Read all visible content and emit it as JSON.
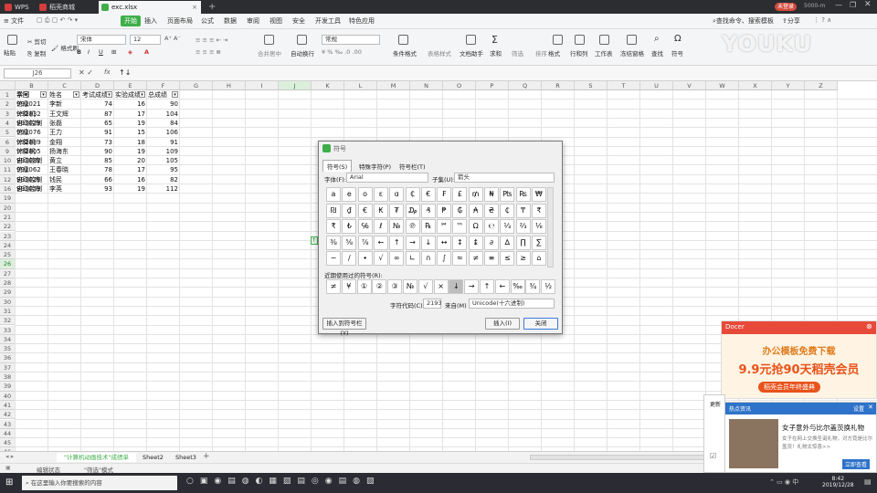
{
  "window": {
    "tabs": [
      {
        "label": "WPS",
        "color": "#d43d3d"
      },
      {
        "label": "稻壳商城",
        "color": "#d43d3d"
      },
      {
        "label": "exc.xlsx",
        "color": "#3fae4a"
      }
    ],
    "new_tab": "+",
    "user": "未登录",
    "user2": "5000-m"
  },
  "menu": {
    "file": "文件",
    "items": [
      "开始",
      "插入",
      "页面布局",
      "公式",
      "数据",
      "审阅",
      "视图",
      "安全",
      "开发工具",
      "特色应用"
    ],
    "search": "查找命令、搜索模板",
    "share": "分享"
  },
  "toolbar": {
    "paste": "粘贴",
    "cut": "剪切",
    "copy": "复制",
    "format_painter": "格式刷",
    "font": "宋体",
    "size": "12",
    "merge": "合并居中",
    "wrap": "自动换行",
    "numfmt": "常规",
    "cond": "条件格式",
    "table_style": "表格样式",
    "doc_assist": "文档助手",
    "sum": "求和",
    "filter": "筛选",
    "sort": "排序",
    "format": "格式",
    "rowcol": "行和列",
    "sheet": "工作表",
    "freeze": "冻结窗格",
    "find": "查找",
    "symbol": "符号",
    "watermark": "YOUKU"
  },
  "formula": {
    "namebox": "J26",
    "fx": "fx",
    "content": "↑↓"
  },
  "sheet": {
    "cols": [
      "A",
      "B",
      "C",
      "D",
      "E",
      "F",
      "G",
      "H",
      "I",
      "J",
      "K",
      "L",
      "M",
      "N",
      "O",
      "P",
      "Q",
      "R",
      "S",
      "T",
      "U",
      "V",
      "W",
      "X",
      "Y",
      "Z"
    ],
    "rows": [
      "1",
      "2",
      "3",
      "4",
      "5",
      "6",
      "9",
      "10",
      "11",
      "12",
      "16",
      "19",
      "20",
      "21",
      "22",
      "23",
      "24",
      "25",
      "26",
      "27",
      "28",
      "29",
      "30",
      "31",
      "32",
      "33",
      "34",
      "35",
      "36",
      "37",
      "38",
      "39",
      "40",
      "41",
      "42",
      "43",
      "44",
      "45",
      "46"
    ],
    "headers": [
      "系别",
      "学号",
      "姓名",
      "考试成绩",
      "实验成绩",
      "总成绩"
    ],
    "data": [
      [
        "信息",
        "991021",
        "李新",
        "74",
        "16",
        "90"
      ],
      [
        "计算机",
        "992032",
        "王文辉",
        "87",
        "17",
        "104"
      ],
      [
        "自动控制",
        "993023",
        "张磊",
        "65",
        "19",
        "84"
      ],
      [
        "信息",
        "991076",
        "王力",
        "91",
        "15",
        "106"
      ],
      [
        "计算机",
        "992089",
        "金翔",
        "73",
        "18",
        "91"
      ],
      [
        "计算机",
        "992005",
        "扬海东",
        "90",
        "19",
        "109"
      ],
      [
        "自动控制",
        "993082",
        "黄立",
        "85",
        "20",
        "105"
      ],
      [
        "信息",
        "991062",
        "王春晓",
        "78",
        "17",
        "95"
      ],
      [
        "自动控制",
        "993026",
        "钱民",
        "66",
        "16",
        "82"
      ],
      [
        "自动控制",
        "993053",
        "李英",
        "93",
        "19",
        "112"
      ]
    ],
    "sheets": [
      "\"计算机动画技术\"成绩单",
      "Sheet2",
      "Sheet3"
    ],
    "add_sheet": "+"
  },
  "status": {
    "mode": "编辑状态",
    "filter": "\"筛选\"模式"
  },
  "dialog": {
    "title": "符号",
    "tabs": [
      "符号(S)",
      "特殊字符(P)",
      "符号栏(T)"
    ],
    "font_label": "字体(F):",
    "font": "Arial",
    "subset_label": "子集(U):",
    "subset": "箭头",
    "grid": [
      [
        "a",
        "e",
        "o",
        "ɛ",
        "ɑ",
        "₵",
        "€",
        "₣",
        "£",
        "₥",
        "₦",
        "₧",
        "₨",
        "₩"
      ],
      [
        "₪",
        "₫",
        "€",
        "₭",
        "₮",
        "₯",
        "₰",
        "₱",
        "₲",
        "₳",
        "₴",
        "₵",
        "₸",
        "₹"
      ],
      [
        "₹",
        "₺",
        "℅",
        "ℓ",
        "№",
        "℗",
        "℞",
        "℠",
        "™",
        "Ω",
        "℮",
        "⅓",
        "⅔",
        "⅛"
      ],
      [
        "⅜",
        "⅝",
        "⅞",
        "←",
        "↑",
        "→",
        "↓",
        "↔",
        "↕",
        "↨",
        "∂",
        "∆",
        "∏",
        "∑"
      ],
      [
        "−",
        "∕",
        "∙",
        "√",
        "∞",
        "∟",
        "∩",
        "∫",
        "≈",
        "≠",
        "≡",
        "≤",
        "≥",
        "⌂"
      ]
    ],
    "recent_label": "近期使用过的符号(R):",
    "recent": [
      "≠",
      "¥",
      "①",
      "②",
      "③",
      "№",
      "√",
      "×",
      "↓",
      "→",
      "↑",
      "←",
      "‰",
      "¾",
      "½"
    ],
    "code_label": "字符代码(C):",
    "code": "2193",
    "from_label": "来自(M)",
    "from": "Unicode(十六进制)",
    "insert_bar": "插入到符号栏(Y)",
    "insert": "插入(I)",
    "close": "关闭"
  },
  "ad1": {
    "brand": "Docer",
    "headline": "办公模板免费下载",
    "price": "9.9元抢90天稻壳会员",
    "sub": "稻壳会员年终盛典"
  },
  "ad2": {
    "label": "热点资讯",
    "settings": "设置",
    "title": "女子意外与比尔盖茨换礼物",
    "desc": "女子在网上交换圣诞礼物，对方竟是比尔盖茨！礼物太惊喜>>",
    "cta": "立即查看"
  },
  "taskbar": {
    "search": "在这里输入你要搜索的内容",
    "time": "8:42",
    "date": "2019/12/28",
    "lang": "中"
  }
}
